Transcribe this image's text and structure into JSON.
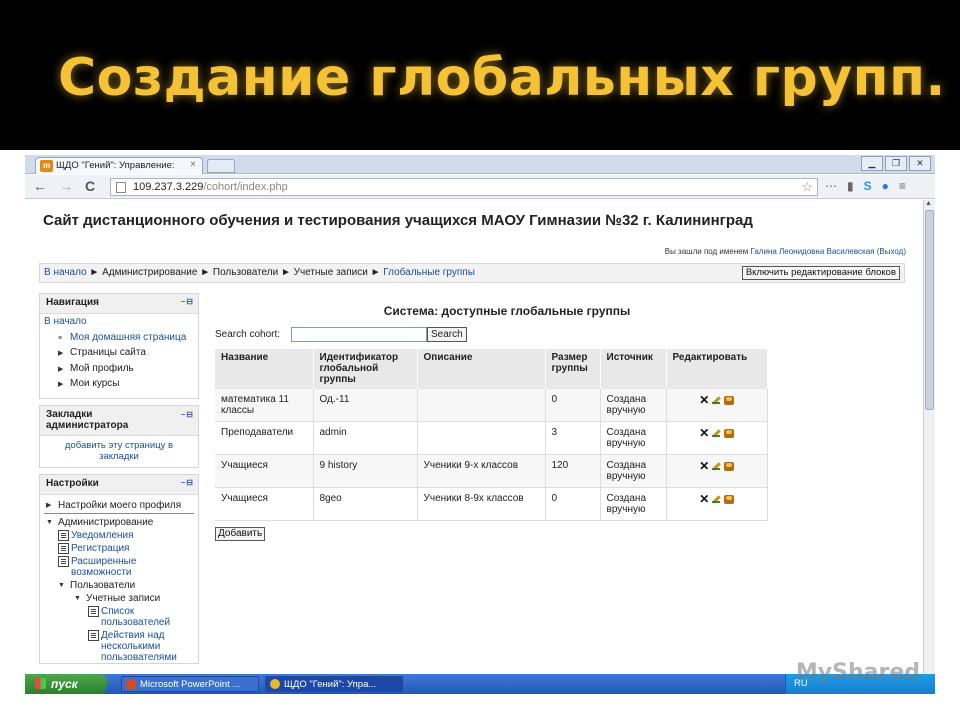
{
  "slide": {
    "title": "Создание глобальных групп."
  },
  "browser": {
    "tab_title": "ЩДО \"Гений\": Управление:",
    "tab_icon_letters": "m",
    "tab_close": "×",
    "url_host": "109.237.3.229",
    "url_path": "/cohort/index.php",
    "win_minimize": "▁",
    "win_restore": "❐",
    "win_close": "✕",
    "back": "←",
    "forward": "→",
    "reload": "C",
    "star": "☆",
    "ext_icons": [
      "wrench-icon",
      "chart-icon",
      "skype-icon",
      "globe-icon",
      "menu-icon"
    ],
    "ext_symbols": [
      "⋯",
      "▮",
      "S",
      "●",
      "≡"
    ]
  },
  "page": {
    "site_title": "Сайт дистанционного обучения и тестирования учащихся МАОУ Гимназии №32 г. Калининград",
    "login_prefix": "Вы зашли под именем ",
    "login_user": "Галина Леонидовна Василевская",
    "login_logout": "(Выход)",
    "breadcrumb": {
      "home": "В начало",
      "sep": " ► ",
      "admin": "Администрирование",
      "users": "Пользователи",
      "accounts": "Учетные записи",
      "cohorts": "Глобальные группы"
    },
    "edit_blocks_button": "Включить редактирование блоков"
  },
  "sidebar": {
    "navigation": {
      "title": "Навигация",
      "controls": "–⊟",
      "home": "В начало",
      "items": [
        {
          "bullet": "≡",
          "label": "Моя домашняя страница",
          "link": true
        },
        {
          "bullet": "▶",
          "label": "Страницы сайта",
          "link": false
        },
        {
          "bullet": "▶",
          "label": "Мой профиль",
          "link": false
        },
        {
          "bullet": "▶",
          "label": "Мои курсы",
          "link": false
        }
      ]
    },
    "admin_bookmarks": {
      "title": "Закладки администратора",
      "controls": "–⊟",
      "link": "добавить эту страницу в закладки"
    },
    "settings": {
      "title": "Настройки",
      "controls": "–⊟",
      "my_profile_settings": "Настройки моего профиля",
      "administration": "Администрирование",
      "notifications": "Уведомления",
      "registration": "Регистрация",
      "advanced": "Расширенные возможности",
      "users": "Пользователи",
      "accounts": "Учетные записи",
      "user_list": "Список пользователей",
      "bulk_actions": "Действия над несколькими пользователями",
      "collapsed": "▶",
      "expanded": "▼"
    }
  },
  "main": {
    "title": "Система: доступные глобальные группы",
    "search_label": "Search cohort:",
    "search_value": "",
    "search_button": "Search",
    "columns": [
      "Название",
      "Идентификатор глобальной группы",
      "Описание",
      "Размер группы",
      "Источник",
      "Редактировать"
    ],
    "rows": [
      {
        "name": "математика 11 классы",
        "id": "Од.-11",
        "desc": "",
        "size": "0",
        "source": "Создана вручную"
      },
      {
        "name": "Преподаватели",
        "id": "admin",
        "desc": "",
        "size": "3",
        "source": "Создана вручную"
      },
      {
        "name": "Учащиеся",
        "id": "9 history",
        "desc": "Ученики 9-х классов",
        "size": "120",
        "source": "Создана вручную"
      },
      {
        "name": "Учащиеся",
        "id": "8geo",
        "desc": "Ученики 8-9х классов",
        "size": "0",
        "source": "Создана вручную"
      }
    ],
    "delete_symbol": "✕",
    "add_button": "Добавить"
  },
  "taskbar": {
    "start": "пуск",
    "items": [
      "Microsoft PowerPoint ...",
      "ЩДО \"Гений\": Упра..."
    ],
    "lang": "RU"
  },
  "watermark": "MyShared",
  "colors": {
    "title_gold": "#f5c236",
    "link_blue": "#1a4f9a",
    "taskbar_blue": "#2456b8",
    "start_green": "#2d7f2d"
  }
}
